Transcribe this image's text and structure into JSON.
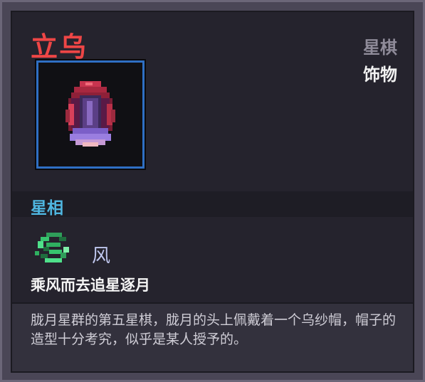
{
  "item": {
    "name": "立乌",
    "category": "星棋",
    "type": "饰物",
    "icon": "hooded-bird-hat-icon"
  },
  "section": {
    "label": "星相"
  },
  "aspect": {
    "icon": "wind-swirl-icon",
    "name": "风",
    "description": "乘风而去追星逐月"
  },
  "lore": "胧月星群的第五星棋，胧月的头上佩戴着一个乌纱帽，帽子的造型十分考究，似乎是某人授予的。",
  "colors": {
    "name": "#ee4646",
    "section": "#4fb6e0",
    "icon_border": "#2f6fc4"
  }
}
